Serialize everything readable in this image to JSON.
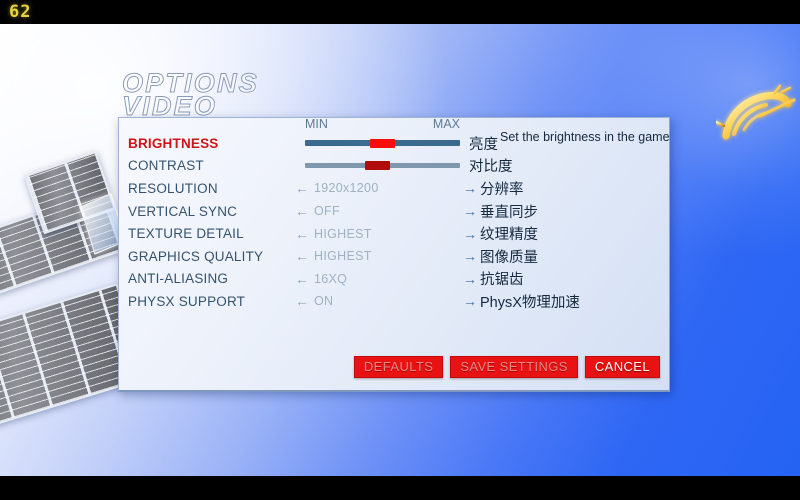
{
  "hud": {
    "fps": "62"
  },
  "menu": {
    "title_line1": "OPTIONS",
    "title_line2": "VIDEO",
    "slider_min_label": "MIN",
    "slider_max_label": "MAX",
    "tooltip": "Set the brightness in the game",
    "arrow_left": "←",
    "arrow_right": "→",
    "options": [
      {
        "label": "BRIGHTNESS",
        "type": "slider",
        "value_percent": 50,
        "localized": "亮度",
        "selected": true,
        "has_localized_arrow": false
      },
      {
        "label": "CONTRAST",
        "type": "slider",
        "value_percent": 46,
        "localized": "对比度",
        "selected": false,
        "has_localized_arrow": false
      },
      {
        "label": "RESOLUTION",
        "type": "cycle",
        "value": "1920x1200",
        "localized": "分辨率",
        "selected": false,
        "has_localized_arrow": true
      },
      {
        "label": "VERTICAL SYNC",
        "type": "cycle",
        "value": "OFF",
        "localized": "垂直同步",
        "selected": false,
        "has_localized_arrow": true
      },
      {
        "label": "TEXTURE DETAIL",
        "type": "cycle",
        "value": "HIGHEST",
        "localized": "纹理精度",
        "selected": false,
        "has_localized_arrow": true
      },
      {
        "label": "GRAPHICS QUALITY",
        "type": "cycle",
        "value": "HIGHEST",
        "localized": "图像质量",
        "selected": false,
        "has_localized_arrow": true
      },
      {
        "label": "ANTI-ALIASING",
        "type": "cycle",
        "value": "16XQ",
        "localized": "抗锯齿",
        "selected": false,
        "has_localized_arrow": true
      },
      {
        "label": "PHYSX SUPPORT",
        "type": "cycle",
        "value": "ON",
        "localized": "PhysX物理加速",
        "selected": false,
        "has_localized_arrow": true
      }
    ],
    "buttons": [
      {
        "label": "DEFAULTS",
        "highlighted": false
      },
      {
        "label": "SAVE SETTINGS",
        "highlighted": false
      },
      {
        "label": "CANCEL",
        "highlighted": true
      }
    ]
  },
  "colors": {
    "accent_red": "#e81212",
    "selected_label": "#d01418",
    "label_blue": "#35536f",
    "value_gray": "#9fb1c4",
    "background_blue": "#2563f3",
    "fps_yellow": "#e8d43c"
  }
}
